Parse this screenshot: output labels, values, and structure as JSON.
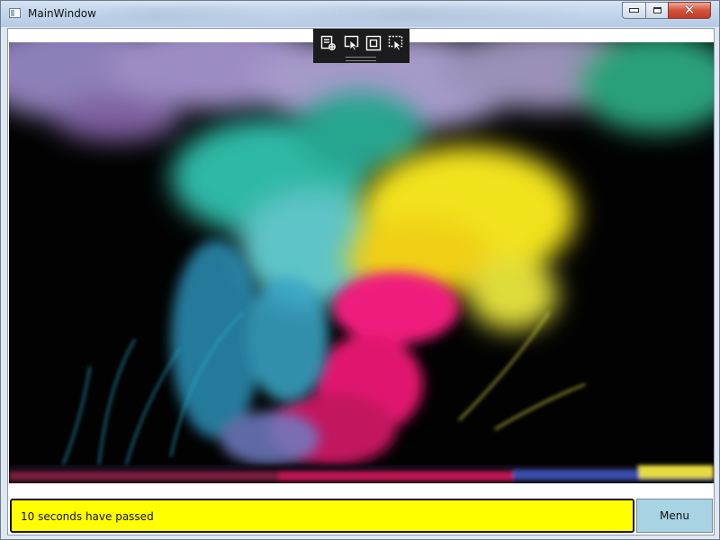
{
  "window": {
    "title": "MainWindow",
    "minimize_icon": "minimize-icon",
    "maximize_icon": "maximize-icon",
    "close_icon": "close-icon"
  },
  "debug_toolbar": {
    "icons": [
      "live-visual-tree-icon",
      "select-element-icon",
      "display-layout-adorners-icon",
      "track-focused-element-icon"
    ]
  },
  "content": {
    "image_subject": "colorful ink clouds in water on black background"
  },
  "status": {
    "message": "10 seconds have passed",
    "background": "#ffff00"
  },
  "menu_button": {
    "label": "Menu",
    "background": "#a7d3e2"
  }
}
